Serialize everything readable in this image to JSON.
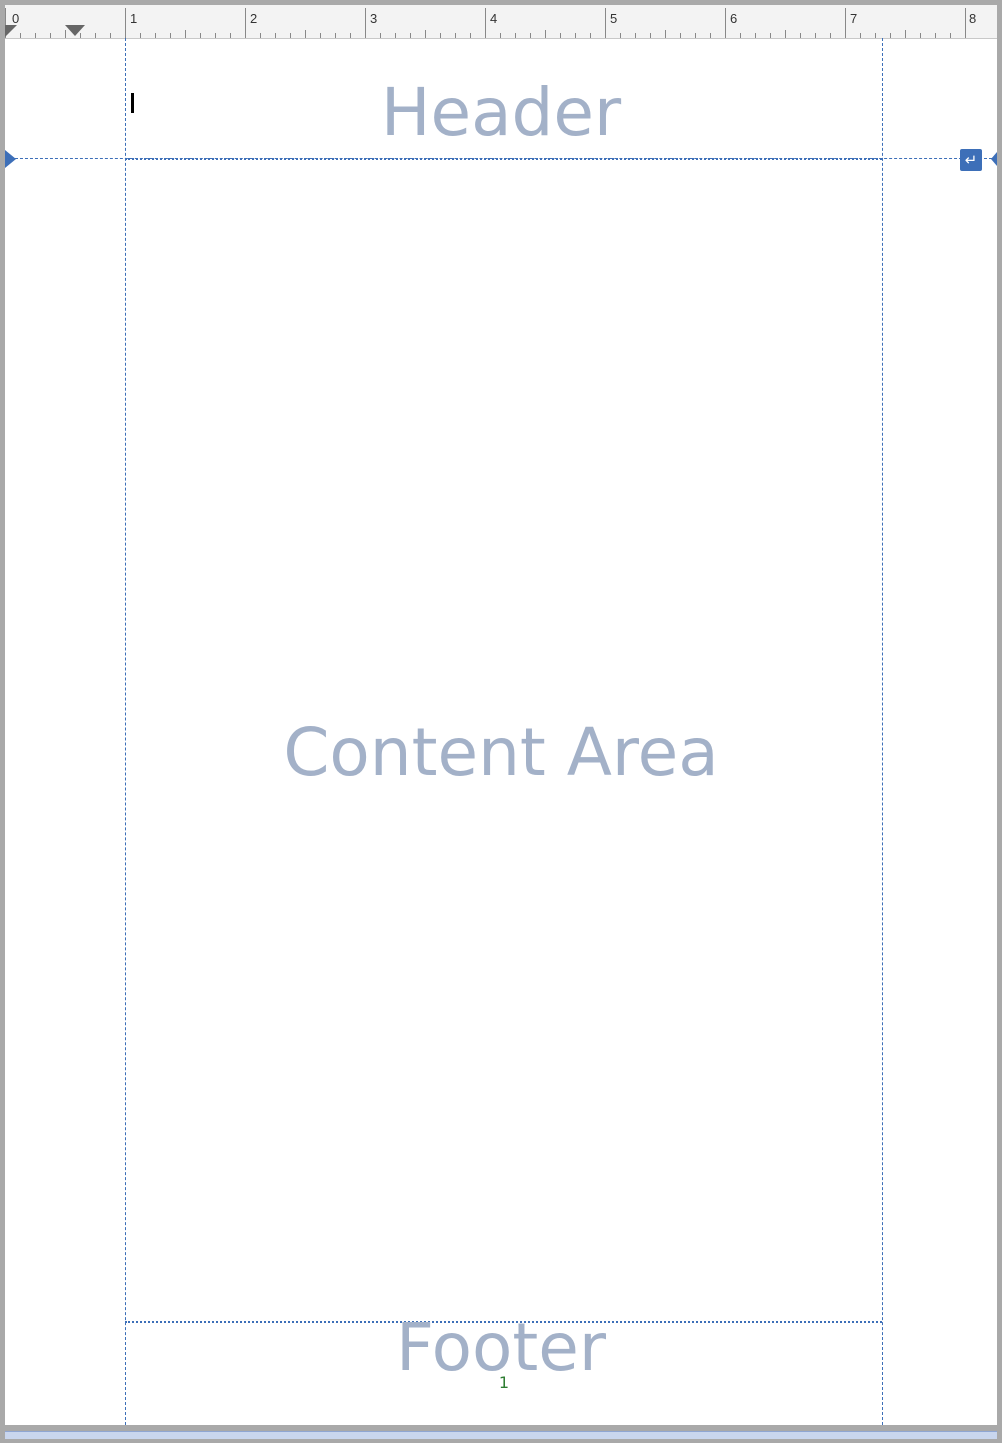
{
  "ruler": {
    "numbers": [
      "0",
      "1",
      "2",
      "3",
      "4",
      "5",
      "6",
      "7",
      "8"
    ]
  },
  "regions": {
    "header": "Header",
    "content": "Content Area",
    "footer": "Footer"
  },
  "footer": {
    "page_number": "1"
  },
  "colors": {
    "guide": "#3d6fb8",
    "placeholder_text": "#a3b1c8",
    "page_number": "#2e7d32"
  },
  "icons": {
    "enter_button": "return-arrow-icon"
  }
}
